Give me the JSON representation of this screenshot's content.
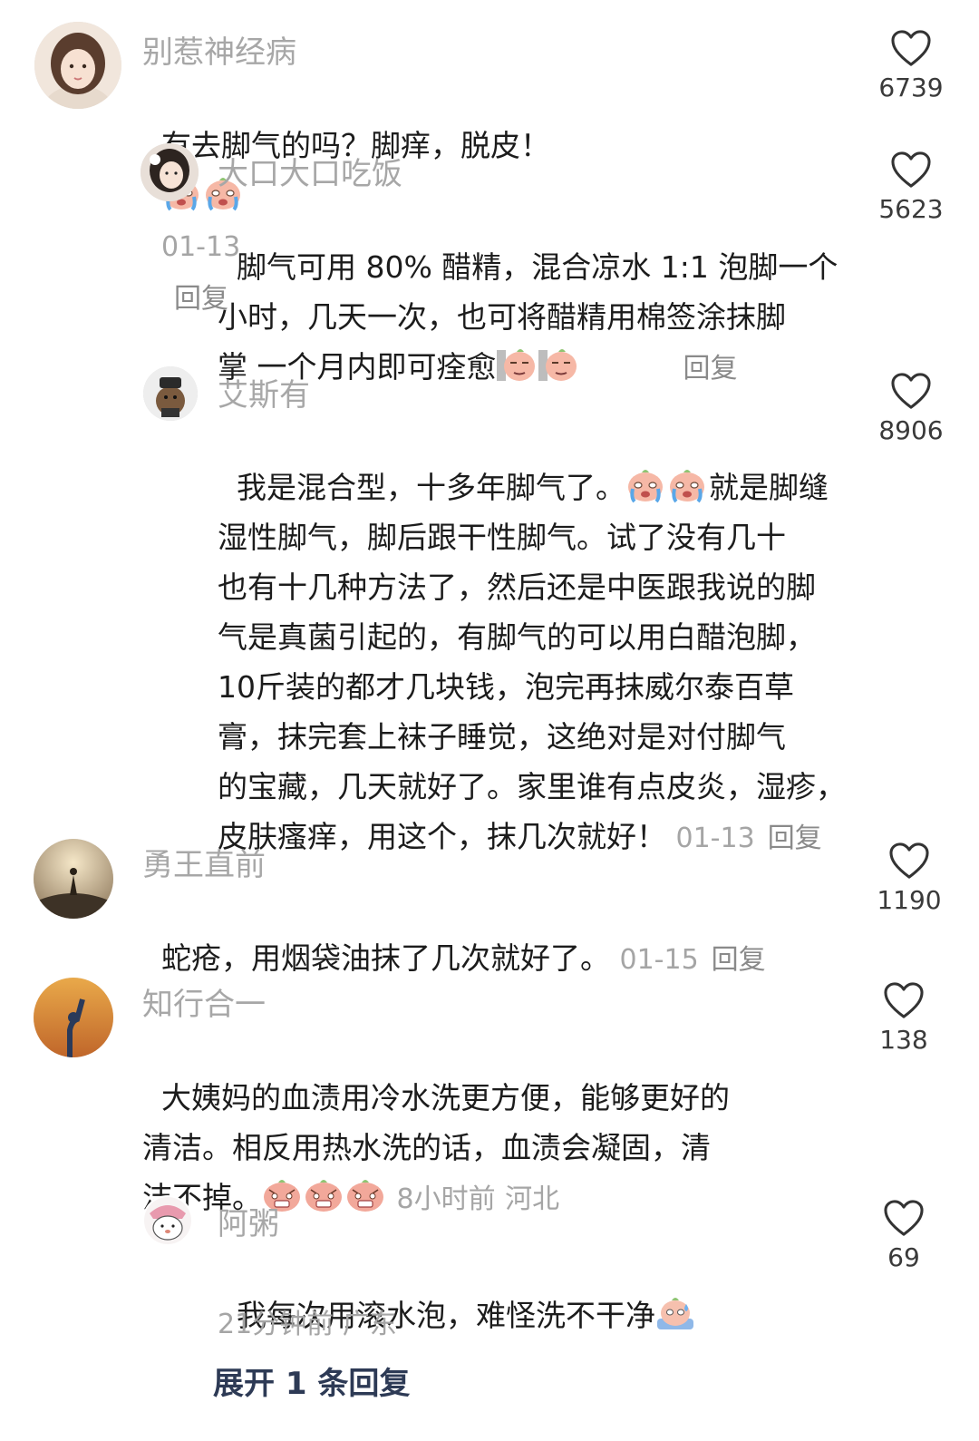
{
  "comments": [
    {
      "username": "别惹神经病",
      "text_before": "有去脚气的吗？脚痒，脱皮！",
      "emojis": [
        "crying-emoji",
        "crying-emoji"
      ],
      "time": "01-13",
      "reply": "回复",
      "likes": "6739"
    },
    {
      "username": "大口大口吃饭",
      "text": "脚气可用 80% 醋精，混合凉水 1:1 泡脚一个\n小时，几天一次，也可将醋精用棉签涂抹脚\n掌 一个月内即可痊愈",
      "emojis": [
        "smug-emoji",
        "smug-emoji"
      ],
      "reply": "回复",
      "likes": "5623"
    },
    {
      "username": "艾斯有",
      "line1_before": "我是混合型，十多年脚气了。",
      "line1_after": "就是脚缝",
      "emojis": [
        "crying-emoji",
        "crying-emoji"
      ],
      "text_rest": "湿性脚气，脚后跟干性脚气。试了没有几十\n也有十几种方法了，然后还是中医跟我说的脚\n气是真菌引起的，有脚气的可以用白醋泡脚，\n10斤装的都才几块钱，泡完再抹威尔泰百草\n膏，抹完套上袜子睡觉，这绝对是对付脚气\n的宝藏，几天就好了。家里谁有点皮炎，湿疹，",
      "last_line": "皮肤瘙痒，用这个，抹几次就好！",
      "time": "01-13",
      "reply": "回复",
      "likes": "8906"
    },
    {
      "username": "勇王直前",
      "text": "蛇疮，用烟袋油抹了几次就好了。",
      "time": "01-15",
      "reply": "回复",
      "likes": "1190"
    },
    {
      "username": "知行合一",
      "text": "大姨妈的血渍用冷水洗更方便，能够更好的\n清洁。相反用热水洗的话，血渍会凝固，清",
      "last_line": "洁不掉。",
      "emojis": [
        "scared-emoji",
        "scared-emoji",
        "scared-emoji"
      ],
      "time": "8小时前",
      "location": "河北",
      "likes": "138"
    },
    {
      "username": "阿粥",
      "text": "我每次用滚水泡，难怪洗不干净",
      "emojis": [
        "sweat-emoji"
      ],
      "time": "21分钟前",
      "location": "广东",
      "likes": "69"
    }
  ],
  "expand_replies": "展开 1 条回复"
}
